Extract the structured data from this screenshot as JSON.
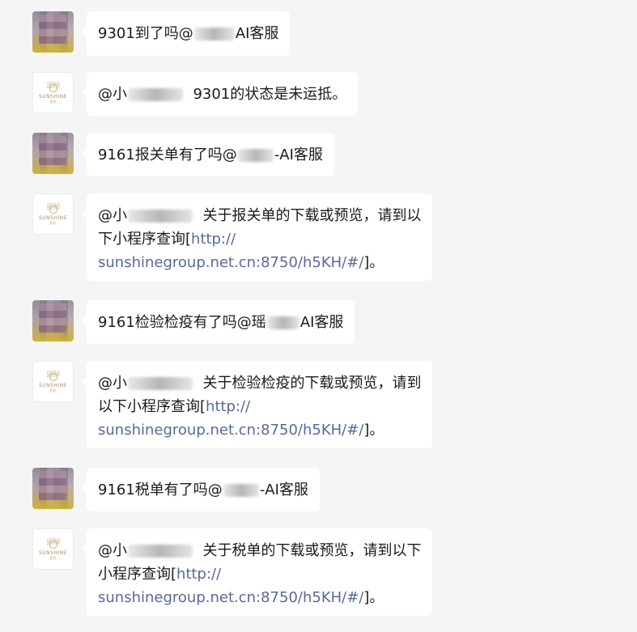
{
  "messages": [
    {
      "sender": "user",
      "pre": "9301到了吗@",
      "post": "AI客服",
      "blur_w": 50
    },
    {
      "sender": "bot",
      "mention": "@小",
      "reply": "9301的状态是未运抵。",
      "blur_w": 68
    },
    {
      "sender": "user",
      "pre": "9161报关单有了吗@",
      "post": "-AI客服",
      "blur_w": 44
    },
    {
      "sender": "bot",
      "mention": "@小",
      "lines": [
        "关于报关单的下载或预览，请到以",
        "下小程序查询[",
        "sunshinegroup.net.cn:8750/h5KH/#/",
        "]。"
      ],
      "blur_w": 80
    },
    {
      "sender": "user",
      "pre": "9161检验检疫有了吗@瑶",
      "post": "AI客服",
      "blur_w": 40
    },
    {
      "sender": "bot",
      "mention": "@小",
      "lines": [
        "关于检验检疫的下载或预览，请到",
        "以下小程序查询[",
        "sunshinegroup.net.cn:8750/h5KH/#/",
        "]。"
      ],
      "blur_w": 80
    },
    {
      "sender": "user",
      "pre": "9161税单有了吗@",
      "post": "-AI客服",
      "blur_w": 44
    },
    {
      "sender": "bot",
      "mention": "@小",
      "lines": [
        "关于税单的下载或预览，请到以下",
        "小程序查询[",
        "sunshinegroup.net.cn:8750/h5KH/#/",
        "]。"
      ],
      "blur_w": 80
    }
  ],
  "link_prefix": "http://",
  "bot_avatar": {
    "brand": "SUNSHINE",
    "sub": "阳光"
  },
  "colors": {
    "background": "#f5f5f5",
    "bubble": "#ffffff",
    "link": "#576b95",
    "text": "#1a1a1a"
  }
}
